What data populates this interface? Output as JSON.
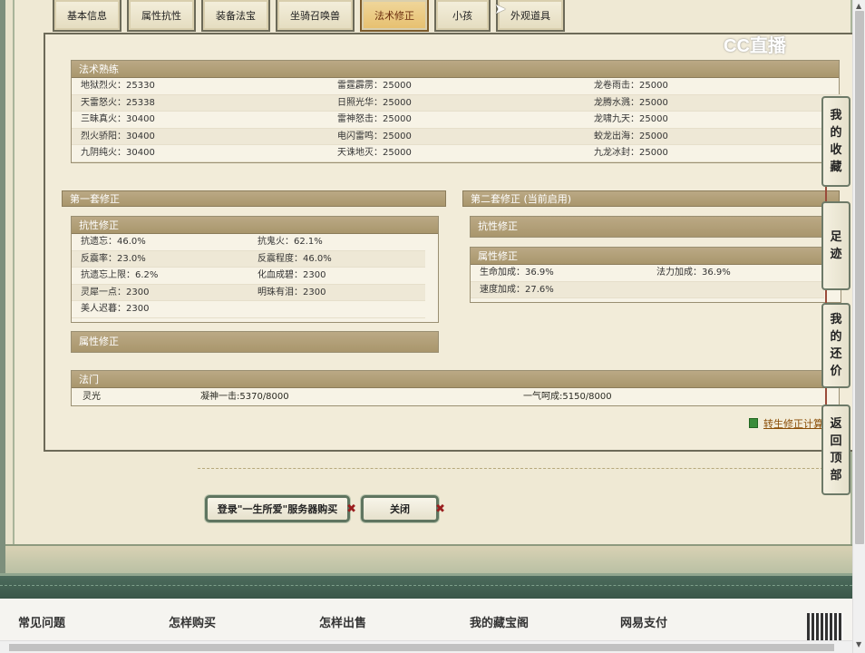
{
  "tabs": [
    "基本信息",
    "属性抗性",
    "装备法宝",
    "坐骑召唤兽",
    "法术修正",
    "小孩",
    "外观道具"
  ],
  "active_tab": "法术修正",
  "logo_text": "CC直播",
  "spell_mastery": {
    "title": "法术熟练",
    "rows": [
      [
        "地狱烈火：25330",
        "雷霆霹雳：25000",
        "龙卷雨击：25000"
      ],
      [
        "天雷怒火：25338",
        "日照光华：25000",
        "龙腾水溅：25000"
      ],
      [
        "三昧真火：30400",
        "雷神怒击：25000",
        "龙啸九天：25000"
      ],
      [
        "烈火骄阳：30400",
        "电闪雷鸣：25000",
        "蛟龙出海：25000"
      ],
      [
        "九阴纯火：30400",
        "天诛地灭：25000",
        "九龙冰封：25000"
      ]
    ]
  },
  "set1": {
    "title": "第一套修正",
    "resist_title": "抗性修正",
    "resist_rows": [
      [
        "抗遗忘：46.0%",
        "抗鬼火：62.1%"
      ],
      [
        "反震率：23.0%",
        "反震程度：46.0%"
      ],
      [
        "抗遗忘上限：6.2%",
        "化血成碧：2300"
      ],
      [
        "灵犀一点：2300",
        "明珠有泪：2300"
      ],
      [
        "美人迟暮：2300",
        ""
      ]
    ],
    "attr_title": "属性修正"
  },
  "set2": {
    "title": "第二套修正 (当前启用)",
    "resist_title": "抗性修正",
    "attr_title": "属性修正",
    "attr_rows": [
      [
        "生命加成：36.9%",
        "法力加成：36.9%"
      ],
      [
        "速度加成：27.6%",
        ""
      ]
    ]
  },
  "famen": {
    "title": "法门",
    "name": "灵光",
    "item1": "凝神一击:5370/8000",
    "item2": "一气呵成:5150/8000"
  },
  "calc_link": "转生修正计算",
  "side_buttons": [
    "我的收藏",
    "足迹",
    "我的还价",
    "返回顶部"
  ],
  "buttons": {
    "login": "登录\"一生所爱\"服务器购买",
    "close": "关闭"
  },
  "footer_items": [
    "常见问题",
    "怎样购买",
    "怎样出售",
    "我的藏宝阁",
    "网易支付"
  ]
}
